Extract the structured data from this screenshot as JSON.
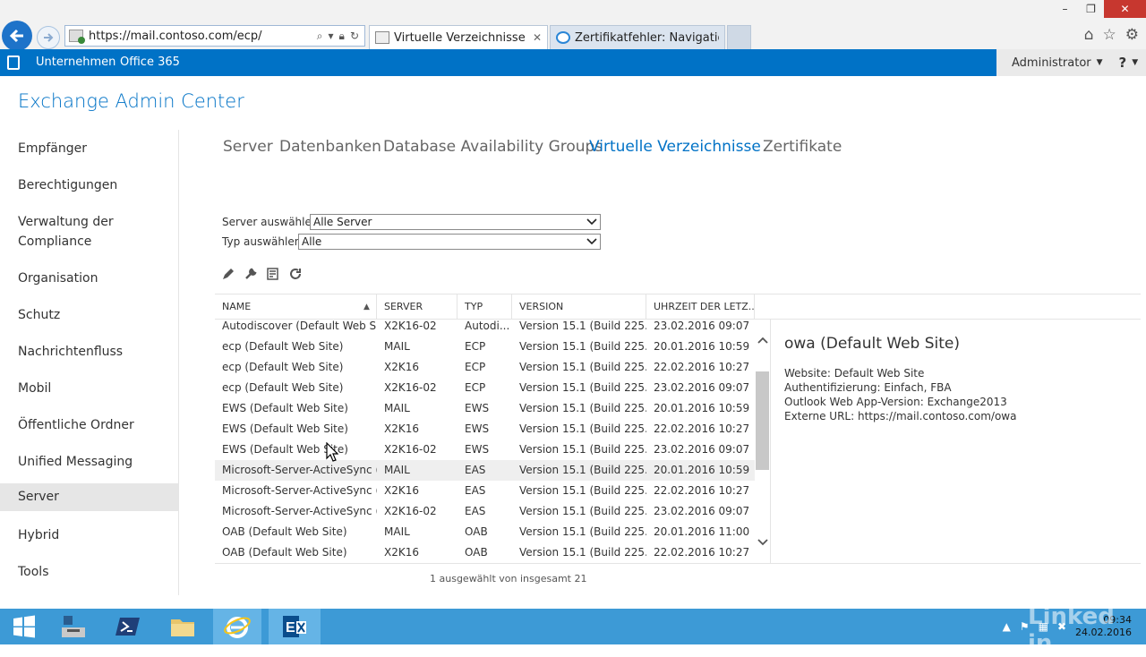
{
  "browser": {
    "url": "https://mail.contoso.com/ecp/",
    "tabs": [
      {
        "title": "Virtuelle Verzeichnisse - Mic...",
        "close": "✕"
      },
      {
        "title": "Zertifikatfehler: Navigation wu..."
      }
    ],
    "window_controls": [
      "–",
      "❐",
      "✕"
    ]
  },
  "suite_bar": {
    "links": [
      "Unternehmen",
      "Office 365"
    ],
    "user": "Administrator",
    "help": "?"
  },
  "app_title": "Exchange Admin Center",
  "left_nav": {
    "items": [
      {
        "label": "Empfänger"
      },
      {
        "label": "Berechtigungen"
      },
      {
        "label": "Verwaltung der Compliance"
      },
      {
        "label": "Organisation"
      },
      {
        "label": "Schutz"
      },
      {
        "label": "Nachrichtenfluss"
      },
      {
        "label": "Mobil"
      },
      {
        "label": "Öffentliche Ordner"
      },
      {
        "label": "Unified Messaging"
      },
      {
        "label": "Server"
      },
      {
        "label": "Hybrid"
      },
      {
        "label": "Tools"
      }
    ],
    "active": "Server"
  },
  "top_tabs": {
    "items": [
      "Server",
      "Datenbanken",
      "Database Availability Groups",
      "Virtuelle Verzeichnisse",
      "Zertifikate"
    ],
    "active": "Virtuelle Verzeichnisse"
  },
  "filters": {
    "server_label": "Server auswählen:",
    "server_value": "Alle Server",
    "type_label": "Typ auswählen:",
    "type_value": "Alle"
  },
  "toolbar": {
    "icons": [
      "edit-icon",
      "wrench-icon",
      "reset-icon",
      "refresh-icon"
    ]
  },
  "grid": {
    "columns": [
      "NAME",
      "SERVER",
      "TYP",
      "VERSION",
      "UHRZEIT DER LETZ..."
    ],
    "rows": [
      [
        "Autodiscover (Default Web Si...",
        "X2K16-02",
        "Autodi...",
        "Version 15.1 (Build 225....",
        "23.02.2016 09:07"
      ],
      [
        "ecp (Default Web Site)",
        "MAIL",
        "ECP",
        "Version 15.1 (Build 225....",
        "20.01.2016 10:59"
      ],
      [
        "ecp (Default Web Site)",
        "X2K16",
        "ECP",
        "Version 15.1 (Build 225....",
        "22.02.2016 10:27"
      ],
      [
        "ecp (Default Web Site)",
        "X2K16-02",
        "ECP",
        "Version 15.1 (Build 225....",
        "23.02.2016 09:07"
      ],
      [
        "EWS (Default Web Site)",
        "MAIL",
        "EWS",
        "Version 15.1 (Build 225....",
        "20.01.2016 10:59"
      ],
      [
        "EWS (Default Web Site)",
        "X2K16",
        "EWS",
        "Version 15.1 (Build 225....",
        "22.02.2016 10:27"
      ],
      [
        "EWS (Default Web Site)",
        "X2K16-02",
        "EWS",
        "Version 15.1 (Build 225....",
        "23.02.2016 09:07"
      ],
      [
        "Microsoft-Server-ActiveSync (...",
        "MAIL",
        "EAS",
        "Version 15.1 (Build 225....",
        "20.01.2016 10:59"
      ],
      [
        "Microsoft-Server-ActiveSync (...",
        "X2K16",
        "EAS",
        "Version 15.1 (Build 225....",
        "22.02.2016 10:27"
      ],
      [
        "Microsoft-Server-ActiveSync (...",
        "X2K16-02",
        "EAS",
        "Version 15.1 (Build 225....",
        "23.02.2016 09:07"
      ],
      [
        "OAB (Default Web Site)",
        "MAIL",
        "OAB",
        "Version 15.1 (Build 225....",
        "20.01.2016 11:00"
      ],
      [
        "OAB (Default Web Site)",
        "X2K16",
        "OAB",
        "Version 15.1 (Build 225....",
        "22.02.2016 10:27"
      ]
    ],
    "selected_row": 7,
    "status": "1 ausgewählt von insgesamt 21"
  },
  "detail": {
    "title": "owa (Default Web Site)",
    "lines": [
      "Website: Default Web Site",
      "Authentifizierung: Einfach, FBA",
      "Outlook Web App-Version: Exchange2013",
      "Externe URL: https://mail.contoso.com/owa"
    ]
  },
  "taskbar": {
    "clock_time": "09:34",
    "clock_date": "24.02.2016",
    "apps": [
      "start",
      "server-manager",
      "powershell",
      "file-explorer",
      "internet-explorer",
      "exchange-management-shell"
    ]
  },
  "watermark": "Linked in",
  "colors": {
    "accent": "#0072c6",
    "taskbar": "#3d9ad6",
    "selected_row": "#efefef"
  }
}
